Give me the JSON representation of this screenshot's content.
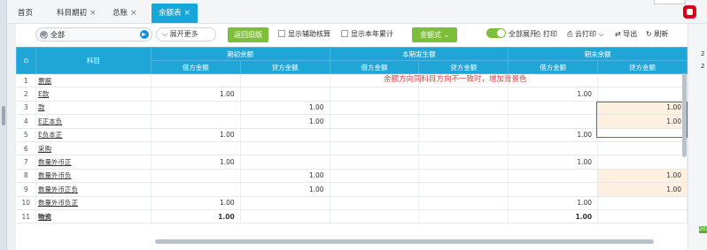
{
  "tabs": [
    {
      "label": "首页",
      "closable": false,
      "active": false
    },
    {
      "label": "科目期初",
      "closable": true,
      "active": false
    },
    {
      "label": "总账",
      "closable": true,
      "active": false
    },
    {
      "label": "余额表",
      "closable": true,
      "active": true
    }
  ],
  "tab_close_glyph": "×",
  "toolbar": {
    "subject_select_value": "全部",
    "expand_more_label": "展开更多",
    "return_old_label": "返回旧版",
    "show_aux_label": "显示辅助核算",
    "show_year_label": "显示本年累计",
    "amount_style_label": "金额式",
    "expand_all_label": "全部展开",
    "print_label": "打印",
    "cloud_print_label": "云打印",
    "export_label": "导出",
    "refresh_label": "刷新"
  },
  "table": {
    "subject_header": "科目",
    "groups": [
      "期初余额",
      "本期发生额",
      "期末余额"
    ],
    "sub_headers": [
      "借方金额",
      "贷方金额",
      "借方金额",
      "贷方金额",
      "借方金额",
      "贷方金额"
    ],
    "rows": [
      {
        "idx": "1",
        "name": "票据",
        "values": [
          "",
          "",
          "",
          "",
          "",
          ""
        ],
        "highlight": false,
        "bold": false
      },
      {
        "idx": "2",
        "name": "E款",
        "values": [
          "1.00",
          "",
          "",
          "",
          "1.00",
          ""
        ],
        "highlight": false,
        "bold": false
      },
      {
        "idx": "3",
        "name": "款",
        "values": [
          "",
          "1.00",
          "",
          "",
          "",
          "1.00"
        ],
        "highlight": true,
        "bold": false
      },
      {
        "idx": "4",
        "name": "E正本负",
        "values": [
          "",
          "1.00",
          "",
          "",
          "",
          "1.00"
        ],
        "highlight": true,
        "bold": false
      },
      {
        "idx": "5",
        "name": "E负本正",
        "values": [
          "1.00",
          "",
          "",
          "",
          "1.00",
          ""
        ],
        "highlight": false,
        "bold": false
      },
      {
        "idx": "6",
        "name": "采购",
        "values": [
          "",
          "",
          "",
          "",
          "",
          ""
        ],
        "highlight": false,
        "bold": false
      },
      {
        "idx": "7",
        "name": "数量外币正",
        "values": [
          "1.00",
          "",
          "",
          "",
          "1.00",
          ""
        ],
        "highlight": false,
        "bold": false
      },
      {
        "idx": "8",
        "name": "数量外币负",
        "values": [
          "",
          "1.00",
          "",
          "",
          "",
          "1.00"
        ],
        "highlight": true,
        "bold": false
      },
      {
        "idx": "9",
        "name": "数量外币正负",
        "values": [
          "",
          "1.00",
          "",
          "",
          "",
          "1.00"
        ],
        "highlight": true,
        "bold": false
      },
      {
        "idx": "10",
        "name": "数量外币负正",
        "values": [
          "1.00",
          "",
          "",
          "",
          "1.00",
          ""
        ],
        "highlight": false,
        "bold": false
      },
      {
        "idx": "11",
        "name": "物资",
        "values": [
          "1.00",
          "",
          "",
          "",
          "1.00",
          ""
        ],
        "highlight": false,
        "bold": true
      }
    ]
  },
  "annotation_text": "余额方向同科目方向不一致时，增加背景色",
  "right_edge_texts": [
    "2",
    "2"
  ],
  "badge_text": "202",
  "colors": {
    "header": "#1fa6d7",
    "active_tab": "#16a6d9",
    "green": "#7dbe3a",
    "highlight": "#fdf0e1",
    "annotation": "#e03a3a"
  }
}
